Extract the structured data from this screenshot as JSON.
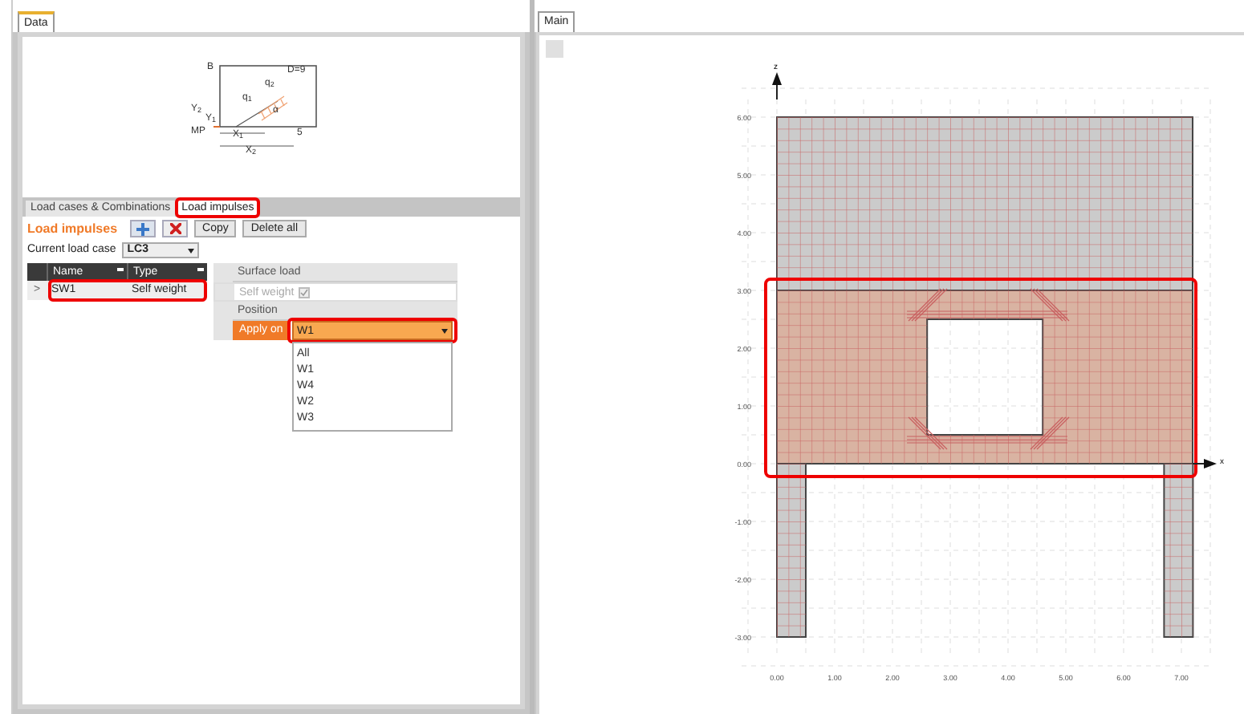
{
  "left_panel": {
    "tab": {
      "label": "Data",
      "selected": true
    },
    "diagram_labels": [
      "B",
      "D=9",
      "q$_{2}$",
      "q$_{1}$",
      "α",
      "Y$_{2}$",
      "Y$_{1}$",
      "MP",
      "X$_{1}$",
      "5",
      "X$_{2}$"
    ],
    "inner_tabs": [
      {
        "label": "Load cases & Combinations",
        "selected": false,
        "highlighted": false
      },
      {
        "label": "Load impulses",
        "selected": true,
        "highlighted": true
      }
    ],
    "toolbar": {
      "title": "Load impulses",
      "buttons": [
        {
          "kind": "add"
        },
        {
          "kind": "delete"
        },
        {
          "kind": "text",
          "label": "Copy"
        },
        {
          "kind": "text",
          "label": "Delete all"
        }
      ]
    },
    "current_load_case": {
      "label": "Current load case",
      "value": "LC3"
    },
    "table": {
      "columns": [
        "Name",
        "Type"
      ],
      "rows": [
        {
          "marker": ">",
          "selected": true,
          "highlighted": true,
          "cells": [
            "SW1",
            "Self weight"
          ]
        }
      ]
    },
    "properties": [
      {
        "kind": "section",
        "label": "Surface load"
      },
      {
        "kind": "checkbox",
        "label": "Self weight",
        "checked": true,
        "disabled": true
      },
      {
        "kind": "section",
        "label": "Position"
      },
      {
        "kind": "dropdown",
        "label": "Apply on",
        "value": "W1",
        "expanded": true,
        "highlighted": true,
        "options": [
          "All",
          "W1",
          "W4",
          "W2",
          "W3"
        ]
      }
    ]
  },
  "main_panel": {
    "tab": {
      "label": "Main",
      "selected": true
    },
    "view": {
      "z_axis": "z",
      "x_axis": "x",
      "highlighted_wall": true,
      "y_ticks": [
        "6.00",
        "5.00",
        "4.00",
        "3.00",
        "2.00",
        "1.00",
        "0.00",
        "-1.00",
        "-2.00",
        "-3.00"
      ],
      "x_ticks": [
        "0.00",
        "1.00",
        "2.00",
        "3.00",
        "4.00",
        "5.00",
        "6.00",
        "7.00"
      ]
    }
  }
}
